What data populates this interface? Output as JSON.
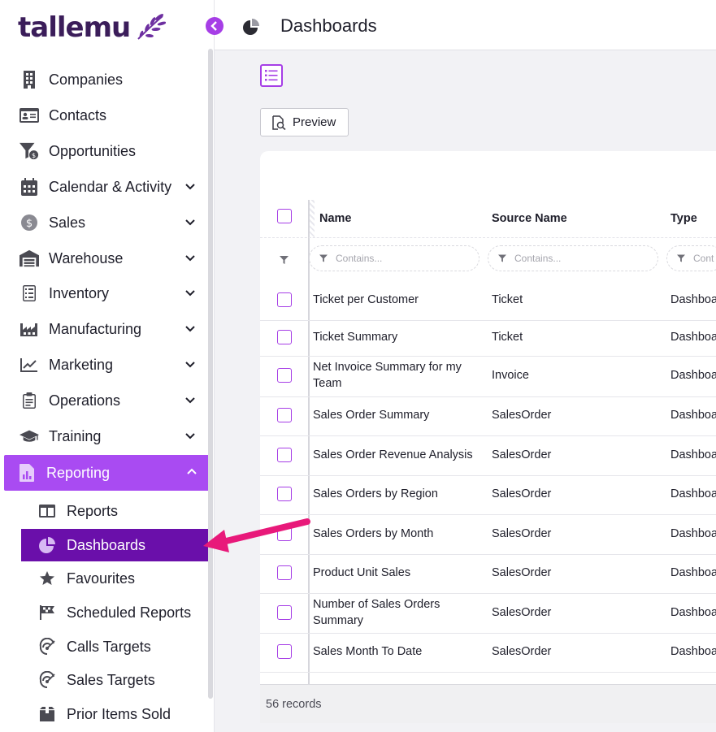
{
  "brand": {
    "logo_text": "tallemu"
  },
  "sidebar": {
    "items": [
      {
        "label": "Companies",
        "icon": "building-icon",
        "has_chevron": false
      },
      {
        "label": "Contacts",
        "icon": "contact-card-icon",
        "has_chevron": false
      },
      {
        "label": "Opportunities",
        "icon": "funnel-dollar-icon",
        "has_chevron": false
      },
      {
        "label": "Calendar & Activity",
        "icon": "calendar-icon",
        "has_chevron": true
      },
      {
        "label": "Sales",
        "icon": "dollar-coin-icon",
        "has_chevron": true
      },
      {
        "label": "Warehouse",
        "icon": "warehouse-icon",
        "has_chevron": true
      },
      {
        "label": "Inventory",
        "icon": "inventory-list-icon",
        "has_chevron": true
      },
      {
        "label": "Manufacturing",
        "icon": "factory-icon",
        "has_chevron": true
      },
      {
        "label": "Marketing",
        "icon": "chart-trend-icon",
        "has_chevron": true
      },
      {
        "label": "Operations",
        "icon": "clipboard-icon",
        "has_chevron": true
      },
      {
        "label": "Training",
        "icon": "graduation-cap-icon",
        "has_chevron": true
      },
      {
        "label": "Reporting",
        "icon": "report-file-icon",
        "has_chevron": true,
        "expanded": true
      }
    ],
    "reporting_children": [
      {
        "label": "Reports",
        "icon": "table-icon"
      },
      {
        "label": "Dashboards",
        "icon": "pie-chart-icon",
        "selected": true
      },
      {
        "label": "Favourites",
        "icon": "star-icon"
      },
      {
        "label": "Scheduled Reports",
        "icon": "flag-icon"
      },
      {
        "label": "Calls Targets",
        "icon": "target-icon"
      },
      {
        "label": "Sales Targets",
        "icon": "target-icon"
      },
      {
        "label": "Prior Items Sold",
        "icon": "box-icon"
      }
    ]
  },
  "header": {
    "title": "Dashboards",
    "icon": "pie-chart-icon"
  },
  "toolbar": {
    "preview_label": "Preview"
  },
  "grid": {
    "columns": [
      "Name",
      "Source Name",
      "Type"
    ],
    "filter_placeholder": "Contains...",
    "filter_placeholder_short": "Cont",
    "rows": [
      {
        "name": "Ticket per Customer",
        "source": "Ticket",
        "type": "Dashboa"
      },
      {
        "name": "Ticket Summary",
        "source": "Ticket",
        "type": "Dashboa"
      },
      {
        "name": "Net Invoice Summary for my Team",
        "source": "Invoice",
        "type": "Dashboa"
      },
      {
        "name": "Sales Order Summary",
        "source": "SalesOrder",
        "type": "Dashboa"
      },
      {
        "name": "Sales Order Revenue Analysis",
        "source": "SalesOrder",
        "type": "Dashboa"
      },
      {
        "name": "Sales Orders by Region",
        "source": "SalesOrder",
        "type": "Dashboa"
      },
      {
        "name": "Sales Orders by Month",
        "source": "SalesOrder",
        "type": "Dashboa"
      },
      {
        "name": "Product Unit Sales",
        "source": "SalesOrder",
        "type": "Dashboa"
      },
      {
        "name": "Number of Sales Orders Summary",
        "source": "SalesOrder",
        "type": "Dashboa"
      },
      {
        "name": "Sales Month To Date",
        "source": "SalesOrder",
        "type": "Dashboa"
      }
    ],
    "footer": "56 records"
  },
  "colors": {
    "brand_purple": "#3b1d5a",
    "accent": "#a63ee6",
    "active_nav": "#a94bf2",
    "selected_sub": "#6a0faa",
    "arrow": "#e8197a"
  }
}
